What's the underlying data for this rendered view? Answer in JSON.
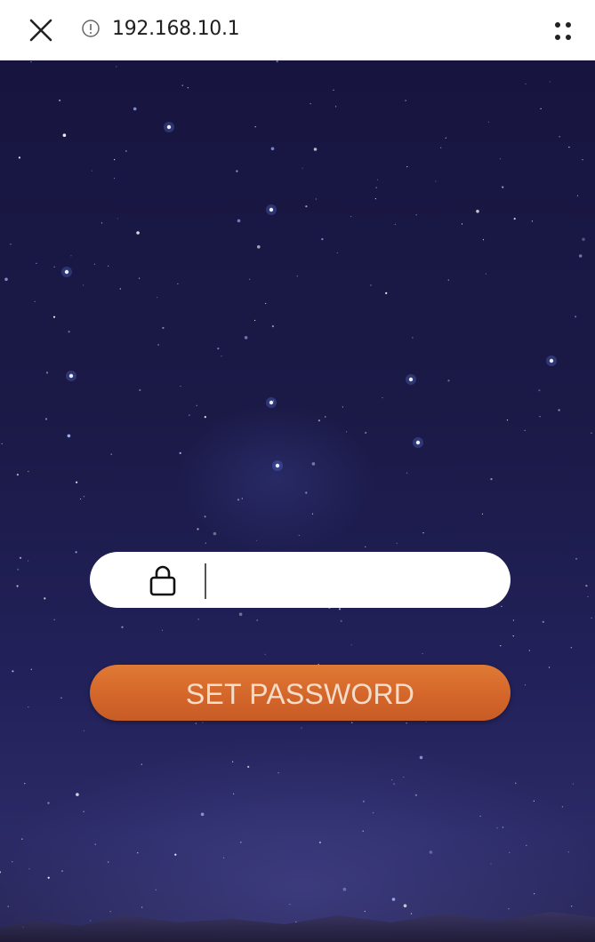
{
  "browser": {
    "url": "192.168.10.1",
    "icons": {
      "close": "close-icon",
      "info": "info-icon",
      "menu": "menu-dots-icon"
    }
  },
  "form": {
    "password_value": "",
    "lock_icon": "lock-icon",
    "submit_label": "SET PASSWORD"
  },
  "colors": {
    "background": "#1b1946",
    "button": "#d4662a",
    "button_text": "#f3dcc9",
    "field": "#ffffff"
  }
}
